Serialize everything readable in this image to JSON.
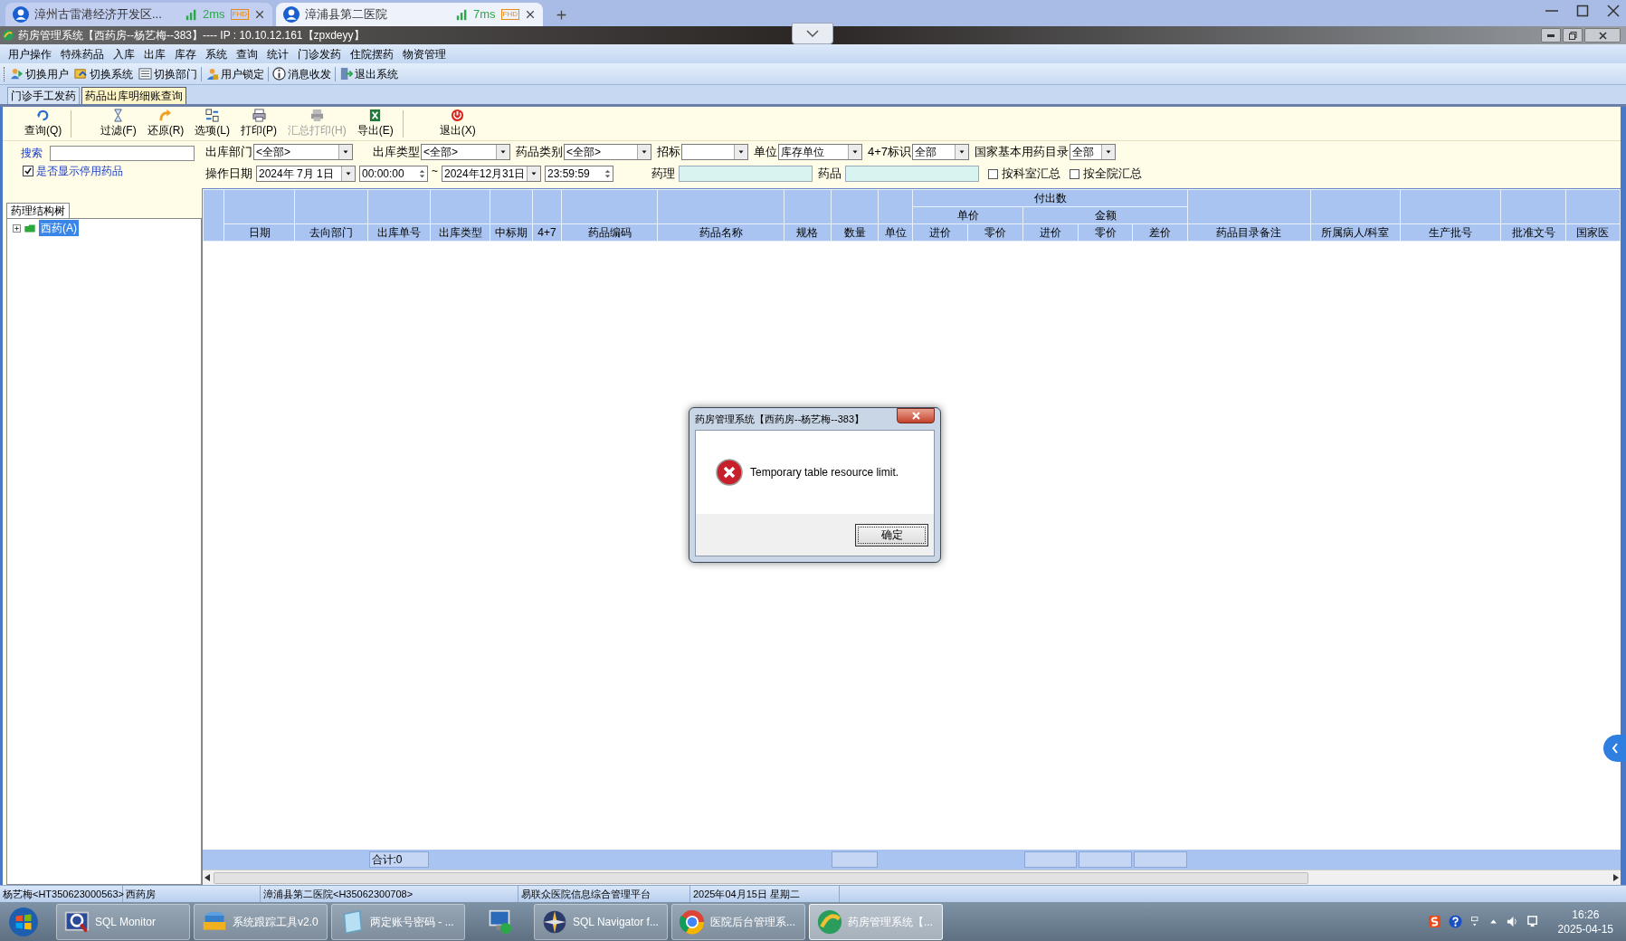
{
  "browser_tabs": [
    {
      "title": "漳州古雷港经济开发区...",
      "latency": "2ms",
      "badge": "FHD",
      "selected": false
    },
    {
      "title": "漳浦县第二医院",
      "latency": "7ms",
      "badge": "FHD",
      "selected": true
    }
  ],
  "window": {
    "title": "药房管理系统【西药房--杨艺梅--383】---- IP : 10.10.12.161【zpxdeyy】"
  },
  "menu": [
    "用户操作",
    "特殊药品",
    "入库",
    "出库",
    "库存",
    "系统",
    "查询",
    "统计",
    "门诊发药",
    "住院摆药",
    "物资管理"
  ],
  "toolbar": [
    "切换用户",
    "切换系统",
    "切换部门",
    "用户锁定",
    "消息收发",
    "退出系统"
  ],
  "doc_tabs": [
    {
      "label": "门诊手工发药",
      "selected": false
    },
    {
      "label": "药品出库明细账查询",
      "selected": true
    }
  ],
  "actions": [
    {
      "label": "查询(Q)",
      "disabled": false
    },
    {
      "label": "过滤(F)",
      "disabled": false
    },
    {
      "label": "还原(R)",
      "disabled": false
    },
    {
      "label": "选项(L)",
      "disabled": false
    },
    {
      "label": "打印(P)",
      "disabled": false
    },
    {
      "label": "汇总打印(H)",
      "disabled": true
    },
    {
      "label": "导出(E)",
      "disabled": false
    },
    {
      "label": "退出(X)",
      "disabled": false
    }
  ],
  "search": {
    "label": "搜索"
  },
  "show_disabled": {
    "label": "是否显示停用药品",
    "checked": true
  },
  "tree_tab": "药理结构树",
  "tree": [
    {
      "label": "西药(A)",
      "expanded": false,
      "selected": true
    }
  ],
  "filters_row1": [
    {
      "label": "出库部门",
      "value": "<全部>"
    },
    {
      "label": "出库类型",
      "value": "<全部>"
    },
    {
      "label": "药品类别",
      "value": "<全部>"
    },
    {
      "label": "招标"
    },
    {
      "label": "单位",
      "value": "库存单位"
    },
    {
      "label": "4+7标识",
      "value": "全部"
    },
    {
      "label": "国家基本用药目录",
      "value": "全部"
    }
  ],
  "date_range": {
    "label": "操作日期",
    "from_date": "2024年 7月 1日",
    "from_time": "00:00:00",
    "separator": "~",
    "to_date": "2024年12月31日",
    "to_time": "23:59:59"
  },
  "text_filters": [
    {
      "label": "药理"
    },
    {
      "label": "药品"
    }
  ],
  "summary_options": [
    {
      "label": "按科室汇总",
      "checked": false
    },
    {
      "label": "按全院汇总",
      "checked": false
    }
  ],
  "table": {
    "columns_before": [
      "日期",
      "去向部门",
      "出库单号",
      "出库类型",
      "中标期",
      "4+7",
      "药品编码",
      "药品名称",
      "规格",
      "数量",
      "单位"
    ],
    "paid_out": {
      "label": "付出数",
      "groups": [
        {
          "label": "单价",
          "columns": [
            "进价",
            "零价"
          ]
        },
        {
          "label": "金额",
          "columns": [
            "进价",
            "零价",
            "差价"
          ]
        }
      ]
    },
    "columns_after": [
      "药品目录备注",
      "所属病人/科室",
      "生产批号",
      "批准文号",
      "国家医"
    ],
    "total": "合计:0"
  },
  "status_bar": [
    "杨艺梅<HT350623000563>",
    "西药房",
    "漳浦县第二医院<H35062300708>",
    "易联众医院信息综合管理平台",
    "2025年04月15日 星期二"
  ],
  "dialog": {
    "title": "药房管理系统【西药房--杨艺梅--383】",
    "message": "Temporary table resource limit.",
    "button": "确定"
  },
  "taskbar": [
    {
      "kind": "app",
      "label": "SQL Monitor",
      "active": false
    },
    {
      "kind": "app",
      "label": "系统跟踪工具v2.0",
      "active": false
    },
    {
      "kind": "app",
      "label": "两定账号密码 - ...",
      "active": false
    },
    {
      "kind": "icon",
      "active": false
    },
    {
      "kind": "app",
      "label": "SQL Navigator f...",
      "active": false
    },
    {
      "kind": "app",
      "label": "医院后台管理系...",
      "active": false
    },
    {
      "kind": "app",
      "label": "药房管理系统【...",
      "active": true
    }
  ],
  "clock": {
    "time": "16:26",
    "date": "2025-04-15"
  }
}
